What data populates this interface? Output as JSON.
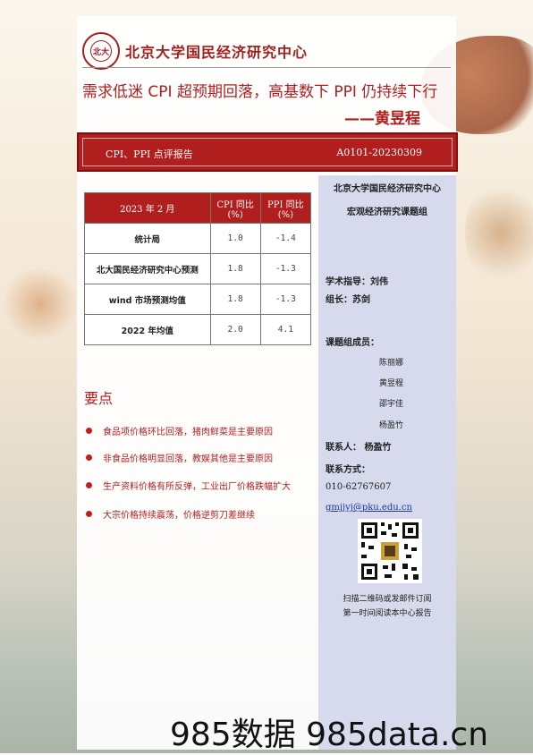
{
  "header": {
    "logo_text": "北京大学国民经济研究中心",
    "seal_text": "北大"
  },
  "report": {
    "title": "需求低迷 CPI 超预期回落，高基数下 PPI 仍持续下行",
    "author": "——黄昱程",
    "category": "CPI、PPI 点评报告",
    "code": "A0101-20230309"
  },
  "table": {
    "headers": [
      "2023 年 2 月",
      "CPI 同比 (%)",
      "PPI 同比 (%)"
    ],
    "rows": [
      {
        "label": "统计局",
        "cpi": "1.0",
        "ppi": "-1.4"
      },
      {
        "label": "北大国民经济研究中心预测",
        "cpi": "1.8",
        "ppi": "-1.3"
      },
      {
        "label": "wind 市场预测均值",
        "cpi": "1.8",
        "ppi": "-1.3"
      },
      {
        "label": "2022 年均值",
        "cpi": "2.0",
        "ppi": "4.1"
      }
    ]
  },
  "key_points": {
    "title": "要点",
    "items": [
      "食品项价格环比回落，猪肉鲜菜是主要原因",
      "非食品价格明显回落，教娱其他是主要原因",
      "生产资料价格有所反弹，工业出厂价格跌幅扩大",
      "大宗价格持续震荡，价格逆剪刀差继续"
    ]
  },
  "sidebar": {
    "org": "北京大学国民经济研究中心",
    "group": "宏观经济研究课题组",
    "advisor": "学术指导：刘伟",
    "leader": "组长：苏剑",
    "members_label": "课题组成员：",
    "members": [
      "陈丽娜",
      "黄昱程",
      "邵宇佳",
      "杨盈竹"
    ],
    "contact_person": "联系人：  杨盈竹",
    "contact_label": "联系方式：",
    "phone": "010-62767607",
    "email": "gmjjyj@pku.edu.cn",
    "qr_caption_1": "扫描二维码或发邮件订阅",
    "qr_caption_2": "第一时间阅读本中心报告"
  },
  "footer": {
    "watermark": "985数据 985data.cn"
  },
  "colors": {
    "brand_red": "#b01e1e",
    "sidebar_bg": "#d6daec"
  }
}
